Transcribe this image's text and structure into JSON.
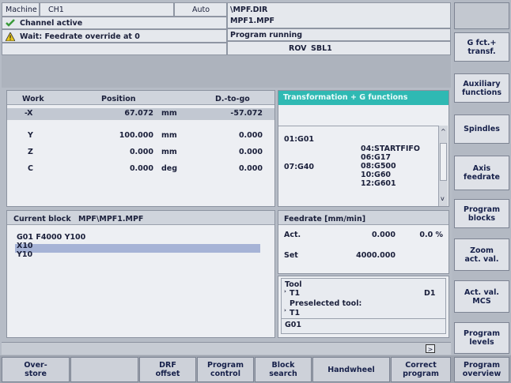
{
  "header": {
    "machine_label": "Machine",
    "channel": "CH1",
    "mode": "Auto",
    "program_path_line1": "\\MPF.DIR",
    "program_path_line2": "MPF1.MPF",
    "channel_status": "Channel active",
    "program_status": "Program running",
    "alarm_text": "Wait: Feedrate override at 0",
    "flag_rov": "ROV",
    "flag_sbl": "SBL1"
  },
  "position_panel": {
    "col_work": "Work",
    "col_position": "Position",
    "col_dtogo": "D.-to-go",
    "rows": [
      {
        "axis": "-X",
        "position": "67.072",
        "unit": "mm",
        "dtogo": "-57.072"
      },
      {
        "axis": "Y",
        "position": "100.000",
        "unit": "mm",
        "dtogo": "0.000"
      },
      {
        "axis": "Z",
        "position": "0.000",
        "unit": "mm",
        "dtogo": "0.000"
      },
      {
        "axis": "C",
        "position": "0.000",
        "unit": "deg",
        "dtogo": "0.000"
      }
    ]
  },
  "gfunc_panel": {
    "title": "Transformation + G functions",
    "left_line1": "01:G01",
    "left_line2": "07:G40",
    "right_lines": [
      "04:STARTFIFO",
      "06:G17",
      "08:G500",
      "10:G60",
      "12:G601"
    ]
  },
  "block_panel": {
    "title": "Current block",
    "program": "MPF\\MPF1.MPF",
    "lines": [
      "G01 F4000 Y100",
      "X10",
      "Y10"
    ]
  },
  "feed_panel": {
    "title": "Feedrate [mm/min]",
    "act_label": "Act.",
    "act_value": "0.000",
    "act_percent": "0.0 %",
    "set_label": "Set",
    "set_value": "4000.000"
  },
  "tool_panel": {
    "title": "Tool",
    "tool": "T1",
    "d_value": "D1",
    "preselected_label": "Preselected tool:",
    "preselected_tool": "T1",
    "gcode": "G01"
  },
  "status_bar": {
    "arrow_icon": "chevron-right-icon"
  },
  "vertical_softkeys": [
    {
      "label": "G fct.+\ntransf."
    },
    {
      "label": "Auxiliary\nfunctions"
    },
    {
      "label": "Spindles"
    },
    {
      "label": "Axis\nfeedrate"
    },
    {
      "label": "Program\nblocks"
    },
    {
      "label": "Zoom\nact. val."
    },
    {
      "label": "Act. val.\nMCS"
    },
    {
      "label": "Program\nlevels"
    }
  ],
  "horizontal_softkeys": [
    {
      "label": "Over-\nstore"
    },
    {
      "label": ""
    },
    {
      "label": "DRF\noffset"
    },
    {
      "label": "Program\ncontrol"
    },
    {
      "label": "Block\nsearch"
    },
    {
      "label": "Handwheel"
    },
    {
      "label": "Correct\nprogram"
    },
    {
      "label": "Program\noverview"
    }
  ],
  "colors": {
    "gfunc_header": "#2fb9b3",
    "highlight_row": "#a6b3d6",
    "ok_icon": "#3a9a3a",
    "warn_icon": "#e7c61b"
  }
}
